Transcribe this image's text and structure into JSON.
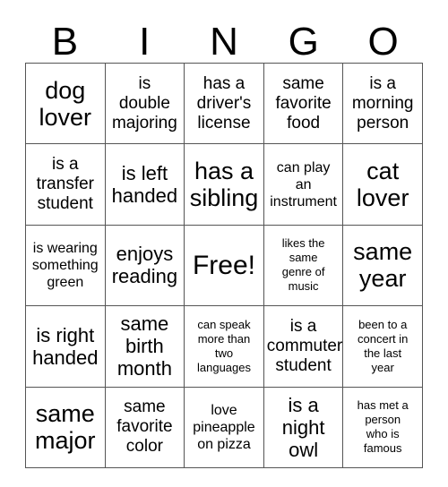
{
  "card": {
    "title": "BINGO",
    "header_letters": [
      "B",
      "I",
      "N",
      "G",
      "O"
    ],
    "grid_size": "5x5",
    "colors": {
      "background": "#ffffff",
      "text": "#000000",
      "border": "#555555"
    },
    "rows": [
      {
        "cells": [
          {
            "text": "dog\nlover",
            "size": "xl"
          },
          {
            "text": "is\ndouble\nmajoring",
            "size": "m"
          },
          {
            "text": "has a\ndriver's\nlicense",
            "size": "m"
          },
          {
            "text": "same\nfavorite\nfood",
            "size": "m"
          },
          {
            "text": "is a\nmorning\nperson",
            "size": "m"
          }
        ]
      },
      {
        "cells": [
          {
            "text": "is a\ntransfer\nstudent",
            "size": "m"
          },
          {
            "text": "is left\nhanded",
            "size": "l"
          },
          {
            "text": "has a\nsibling",
            "size": "xl"
          },
          {
            "text": "can play\nan\ninstrument",
            "size": "s"
          },
          {
            "text": "cat\nlover",
            "size": "xl"
          }
        ]
      },
      {
        "cells": [
          {
            "text": "is wearing\nsomething\ngreen",
            "size": "s"
          },
          {
            "text": "enjoys\nreading",
            "size": "l"
          },
          {
            "text": "Free!",
            "size": "xxl"
          },
          {
            "text": "likes the\nsame\ngenre of\nmusic",
            "size": "xs"
          },
          {
            "text": "same\nyear",
            "size": "xl"
          }
        ]
      },
      {
        "cells": [
          {
            "text": "is right\nhanded",
            "size": "l"
          },
          {
            "text": "same\nbirth\nmonth",
            "size": "l"
          },
          {
            "text": "can speak\nmore than\ntwo\nlanguages",
            "size": "xs"
          },
          {
            "text": "is a\ncommuter\nstudent",
            "size": "m"
          },
          {
            "text": "been to a\nconcert in\nthe last\nyear",
            "size": "xs"
          }
        ]
      },
      {
        "cells": [
          {
            "text": "same\nmajor",
            "size": "xl"
          },
          {
            "text": "same\nfavorite\ncolor",
            "size": "m"
          },
          {
            "text": "love\npineapple\non pizza",
            "size": "s"
          },
          {
            "text": "is a\nnight\nowl",
            "size": "l"
          },
          {
            "text": "has met a\nperson\nwho is\nfamous",
            "size": "xs"
          }
        ]
      }
    ]
  }
}
